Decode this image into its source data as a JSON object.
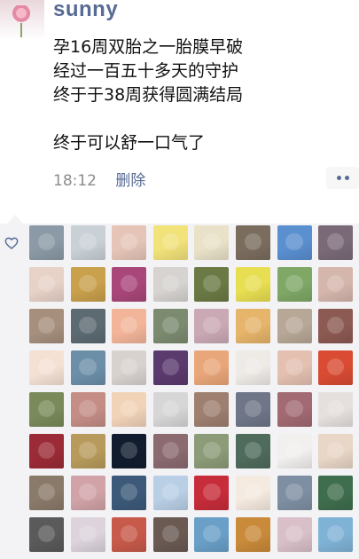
{
  "post": {
    "username": "sunny",
    "lines": [
      "孕16周双胎之一胎膜早破",
      "经过一百五十多天的守护",
      "终于于38周获得圆满结局",
      "终于可以舒一口气了"
    ],
    "time": "18:12",
    "delete_label": "删除"
  },
  "icons": {
    "like": "heart-outline-icon",
    "more": "more-dots-icon"
  },
  "colors": {
    "name_blue": "#576b95",
    "likes_background": "#f3f3f5"
  },
  "likes": {
    "avatars": [
      "#8b9aa6",
      "#c9d0d6",
      "#e6c5b8",
      "#f2e27a",
      "#e9e2c9",
      "#7b6d5e",
      "#5a8fd0",
      "#7a6a78",
      "#e7d2c7",
      "#c9a04c",
      "#a9477a",
      "#d6d3d0",
      "#6b7a45",
      "#e8de52",
      "#7fa867",
      "#d5b6ad",
      "#a68f7d",
      "#5c6a72",
      "#f3b59a",
      "#7c8b70",
      "#caa9b5",
      "#e6b46a",
      "#b7a796",
      "#8c5a52",
      "#f4e1d4",
      "#6c8fa8",
      "#d8d2cf",
      "#5b3a6e",
      "#e9a679",
      "#eeeae6",
      "#e3c0b0",
      "#d94b33",
      "#7a8a5a",
      "#c48d86",
      "#f1d3b8",
      "#d6d6d6",
      "#9e7f70",
      "#6f7688",
      "#a26a72",
      "#e5e0dd",
      "#9b2b36",
      "#b89b5c",
      "#111c2e",
      "#8b6a70",
      "#8c9b78",
      "#4f6b5c",
      "#f2f0ee",
      "#e8d6c6",
      "#8a7a6a",
      "#d1a3a8",
      "#3d5a7a",
      "#b9cfe6",
      "#c72c3a",
      "#f5eadf",
      "#7f8fa3",
      "#3f6e4e",
      "#5a5a5a",
      "#dcd3dc",
      "#c75a4a",
      "#6a5a52",
      "#6aa0c8",
      "#c98a3a",
      "#d9c0c8",
      "#7fb3d6"
    ]
  }
}
